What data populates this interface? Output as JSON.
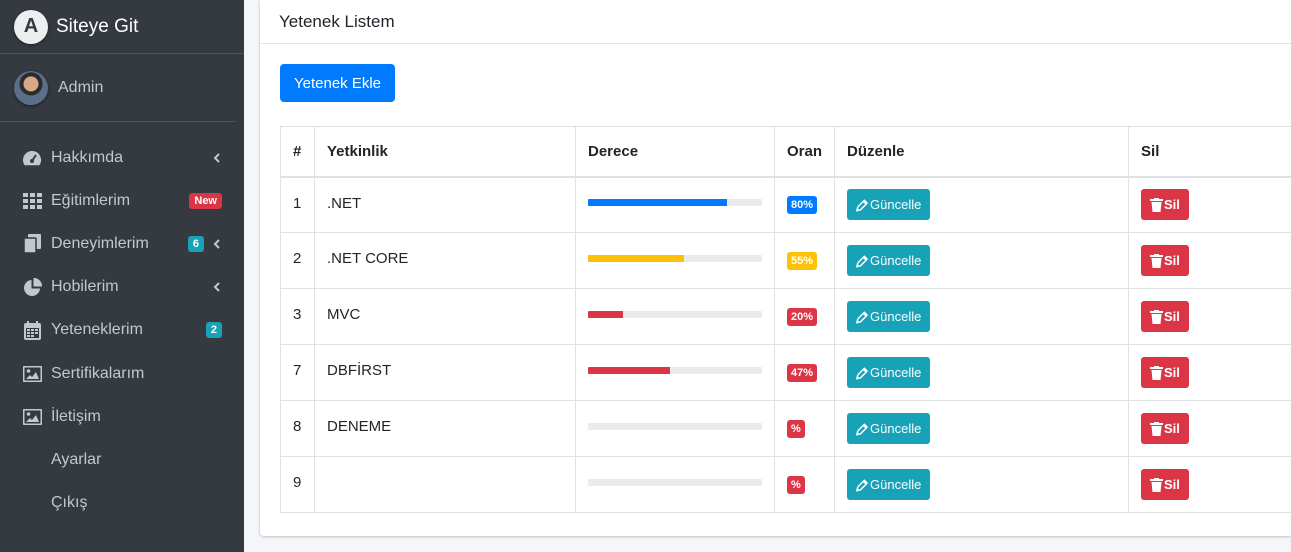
{
  "brand": {
    "title": "Siteye Git",
    "logo_letter": "A"
  },
  "user": {
    "name": "Admin"
  },
  "sidebar": {
    "items": [
      {
        "label": "Hakkımda",
        "icon": "dashboard-gauge-icon",
        "chevron": true
      },
      {
        "label": "Eğitimlerim",
        "icon": "grid-icon",
        "badge": "New",
        "badge_color": "#dc3545"
      },
      {
        "label": "Deneyimlerim",
        "icon": "copy-icon",
        "badge": "6",
        "badge_color": "#17a2b8",
        "chevron": true
      },
      {
        "label": "Hobilerim",
        "icon": "pie-chart-icon",
        "chevron": true
      },
      {
        "label": "Yeteneklerim",
        "icon": "calendar-icon",
        "badge": "2",
        "badge_color": "#17a2b8"
      },
      {
        "label": "Sertifikalarım",
        "icon": "image-icon"
      },
      {
        "label": "İletişim",
        "icon": "image-icon"
      },
      {
        "label": "Ayarlar"
      },
      {
        "label": "Çıkış"
      }
    ]
  },
  "card": {
    "title": "Yetenek Listem",
    "add_button": "Yetenek Ekle"
  },
  "table": {
    "headers": [
      "#",
      "Yetkinlik",
      "Derece",
      "Oran",
      "Düzenle",
      "Sil"
    ],
    "edit_label": "Güncelle",
    "delete_label": "Sil",
    "rows": [
      {
        "id": "1",
        "skill": ".NET",
        "progress": 80,
        "rate": "80%",
        "color": "#007bff"
      },
      {
        "id": "2",
        "skill": ".NET CORE",
        "progress": 55,
        "rate": "55%",
        "color": "#ffc107"
      },
      {
        "id": "3",
        "skill": "MVC",
        "progress": 20,
        "rate": "20%",
        "color": "#dc3545"
      },
      {
        "id": "7",
        "skill": "DBFİRST",
        "progress": 47,
        "rate": "47%",
        "color": "#dc3545"
      },
      {
        "id": "8",
        "skill": "DENEME",
        "progress": 0,
        "rate": "%",
        "color": "#dc3545"
      },
      {
        "id": "9",
        "skill": "",
        "progress": 0,
        "rate": "%",
        "color": "#dc3545"
      }
    ]
  }
}
